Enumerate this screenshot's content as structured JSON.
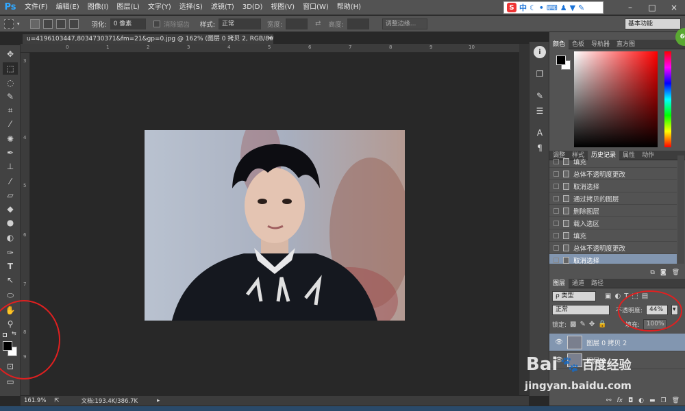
{
  "app": {
    "logo": "Ps"
  },
  "menu": [
    "文件(F)",
    "编辑(E)",
    "图像(I)",
    "图层(L)",
    "文字(Y)",
    "选择(S)",
    "滤镜(T)",
    "3D(D)",
    "视图(V)",
    "窗口(W)",
    "帮助(H)"
  ],
  "ime": {
    "brand": "S",
    "label": "中"
  },
  "window_controls": {
    "minimize": "–",
    "restore": "□",
    "close": "×"
  },
  "options": {
    "feather_label": "羽化:",
    "feather_value": "0 像素",
    "antialias_label": "消除锯齿",
    "style_label": "样式:",
    "style_value": "正常",
    "width_label": "宽度:",
    "height_label": "高度:",
    "refine_edge": "调整边缘...",
    "workspace": "基本功能"
  },
  "doc_tab": "u=4196103447,8034730371&fm=21&gp=0.jpg @ 162% (图层 0 拷贝 2, RGB/8#) *",
  "ruler_left_ticks": [
    "3",
    "4",
    "5",
    "6",
    "7",
    "8",
    "9"
  ],
  "ruler_top_ticks": [
    "0",
    "1",
    "2",
    "3",
    "4",
    "5",
    "6",
    "7",
    "8",
    "9",
    "10"
  ],
  "status": {
    "zoom": "161.9%",
    "doc": "文档:193.4K/386.7K"
  },
  "color_panel": {
    "tabs": [
      "颜色",
      "色板",
      "导航器",
      "直方图"
    ]
  },
  "history_panel": {
    "tabs": [
      "调整",
      "样式",
      "历史记录",
      "属性",
      "动作"
    ],
    "items": [
      "填充",
      "总体不透明度更改",
      "取消选择",
      "通过拷贝的图层",
      "删除图层",
      "载入选区",
      "填充",
      "总体不透明度更改",
      "取消选择"
    ],
    "selected_index": 8
  },
  "layers_panel": {
    "tabs": [
      "图层",
      "通道",
      "路径"
    ],
    "filter": "ρ 类型",
    "blend_mode": "正常",
    "opacity_label": "不透明度:",
    "opacity_value": "44%",
    "lock_label": "锁定:",
    "fill_label": "填充:",
    "fill_value": "100%",
    "layers": [
      {
        "name": "图层 0 拷贝 2",
        "selected": true
      },
      {
        "name": "图层 0",
        "selected": false
      }
    ],
    "footer_icons": [
      "link-icon",
      "fx-icon",
      "mask-icon",
      "adjustment-icon",
      "folder-icon",
      "new-layer-icon",
      "trash-icon"
    ]
  },
  "watermark": {
    "brand": "Bai",
    "brand2": "百度经验",
    "url": "jingyan.baidu.com"
  },
  "badge": "60",
  "colors": {
    "selection": "#8296b0",
    "annotation": "#e02020"
  }
}
